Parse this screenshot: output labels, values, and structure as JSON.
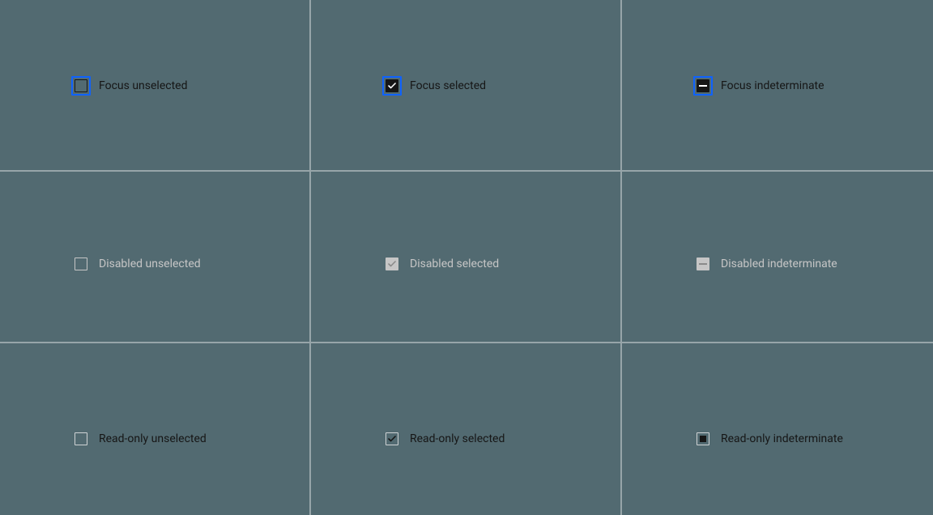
{
  "cells": {
    "focus_unselected": {
      "label": "Focus unselected"
    },
    "focus_selected": {
      "label": "Focus selected"
    },
    "focus_indeterminate": {
      "label": "Focus indeterminate"
    },
    "disabled_unselected": {
      "label": "Disabled unselected"
    },
    "disabled_selected": {
      "label": "Disabled selected"
    },
    "disabled_indeterminate": {
      "label": "Disabled indeterminate"
    },
    "readonly_unselected": {
      "label": "Read-only unselected"
    },
    "readonly_selected": {
      "label": "Read-only selected"
    },
    "readonly_indeterminate": {
      "label": "Read-only indeterminate"
    }
  },
  "colors": {
    "focus_ring": "#0f62fe",
    "checkbox_fill": "#161616",
    "disabled": "#c6c6c6",
    "readonly_border": "#cfd3d5",
    "background": "#526a71",
    "grid_line": "rgba(255,255,255,0.4)"
  }
}
